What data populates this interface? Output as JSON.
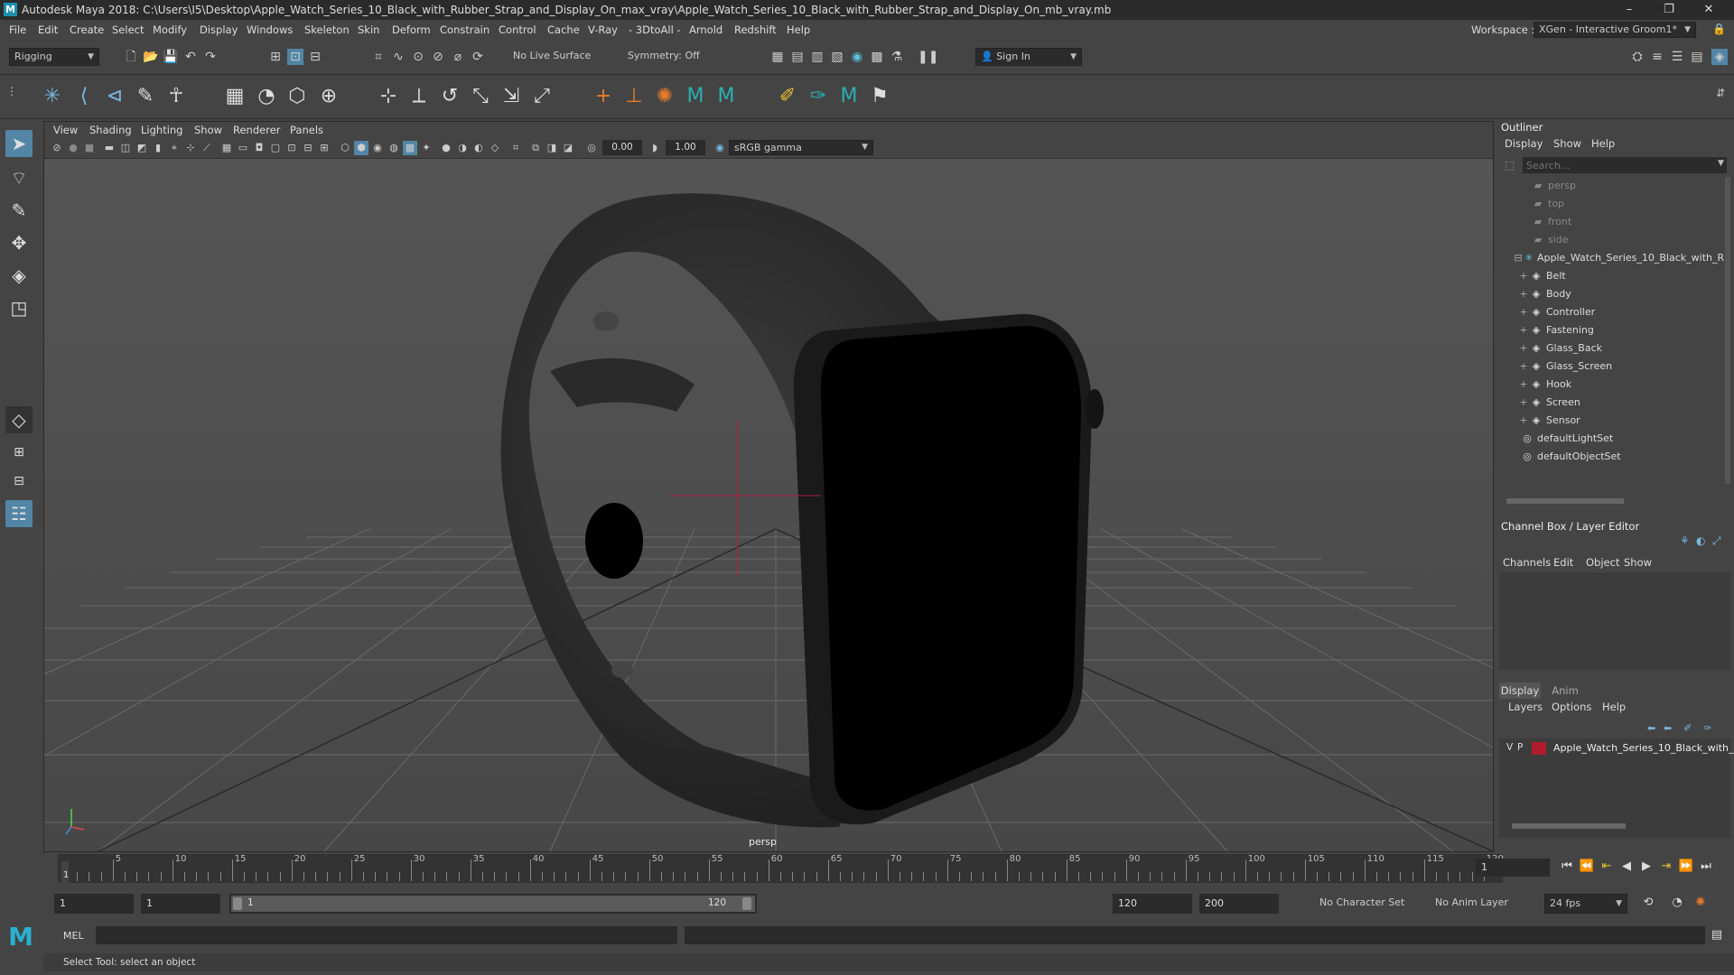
{
  "window": {
    "title": "Autodesk Maya 2018: C:\\Users\\I5\\Desktop\\Apple_Watch_Series_10_Black_with_Rubber_Strap_and_Display_On_max_vray\\Apple_Watch_Series_10_Black_with_Rubber_Strap_and_Display_On_mb_vray.mb",
    "app_icon": "M",
    "minimize": "–",
    "restore": "❐",
    "close": "✕"
  },
  "menubar": {
    "items": [
      "File",
      "Edit",
      "Create",
      "Select",
      "Modify",
      "Display",
      "Windows",
      "Skeleton",
      "Skin",
      "Deform",
      "Constrain",
      "Control",
      "Cache",
      "V-Ray",
      "- 3DtoAll -",
      "Arnold",
      "Redshift",
      "Help"
    ],
    "workspace_label": "Workspace :",
    "workspace_value": "XGen - Interactive Groom1*"
  },
  "statusline": {
    "mode": "Rigging",
    "live_surface": "No Live Surface",
    "symmetry": "Symmetry: Off",
    "sign_in": "Sign In"
  },
  "viewport": {
    "menus": [
      "View",
      "Shading",
      "Lighting",
      "Show",
      "Renderer",
      "Panels"
    ],
    "exposure": "0.00",
    "gamma": "1.00",
    "color_space": "sRGB gamma",
    "camera_label": "persp"
  },
  "outliner": {
    "title": "Outliner",
    "menus": [
      "Display",
      "Show",
      "Help"
    ],
    "search_placeholder": "Search...",
    "items": [
      {
        "label": "persp",
        "icon": "camera-icon",
        "dim": true
      },
      {
        "label": "top",
        "icon": "camera-icon",
        "dim": true
      },
      {
        "label": "front",
        "icon": "camera-icon",
        "dim": true
      },
      {
        "label": "side",
        "icon": "camera-icon",
        "dim": true
      },
      {
        "label": "Apple_Watch_Series_10_Black_with_R",
        "icon": "group-icon"
      },
      {
        "label": "Belt",
        "icon": "mesh-icon"
      },
      {
        "label": "Body",
        "icon": "mesh-icon"
      },
      {
        "label": "Controller",
        "icon": "mesh-icon"
      },
      {
        "label": "Fastening",
        "icon": "mesh-icon"
      },
      {
        "label": "Glass_Back",
        "icon": "mesh-icon"
      },
      {
        "label": "Glass_Screen",
        "icon": "mesh-icon"
      },
      {
        "label": "Hook",
        "icon": "mesh-icon"
      },
      {
        "label": "Screen",
        "icon": "mesh-icon"
      },
      {
        "label": "Sensor",
        "icon": "mesh-icon"
      },
      {
        "label": "defaultLightSet",
        "icon": "set-icon"
      },
      {
        "label": "defaultObjectSet",
        "icon": "set-icon"
      }
    ]
  },
  "channelbox": {
    "title": "Channel Box / Layer Editor",
    "menus": [
      "Channels",
      "Edit",
      "Object",
      "Show"
    ],
    "tabs": [
      "Display",
      "Anim"
    ],
    "layer_menus": [
      "Layers",
      "Options",
      "Help"
    ],
    "layer": {
      "v": "V",
      "p": "P",
      "name": "Apple_Watch_Series_10_Black_with_R",
      "color": "#b01c2e"
    }
  },
  "timeline": {
    "ticks": [
      "5",
      "10",
      "15",
      "20",
      "25",
      "30",
      "35",
      "40",
      "45",
      "50",
      "55",
      "60",
      "65",
      "70",
      "75",
      "80",
      "85",
      "90",
      "95",
      "100",
      "105",
      "110",
      "115",
      "120"
    ],
    "current_marker": "1",
    "current_frame": "1"
  },
  "range": {
    "start": "1",
    "playback_start": "1",
    "slider_start": "1",
    "slider_end": "120",
    "playback_end": "120",
    "end": "200",
    "character_set": "No Character Set",
    "anim_layer": "No Anim Layer",
    "fps": "24 fps"
  },
  "commandline": {
    "label": "MEL"
  },
  "helpline": {
    "text": "Select Tool: select an object"
  },
  "colors": {
    "accent": "#5285a6",
    "background": "#444444",
    "viewport_bg": "#4d4d4d"
  }
}
